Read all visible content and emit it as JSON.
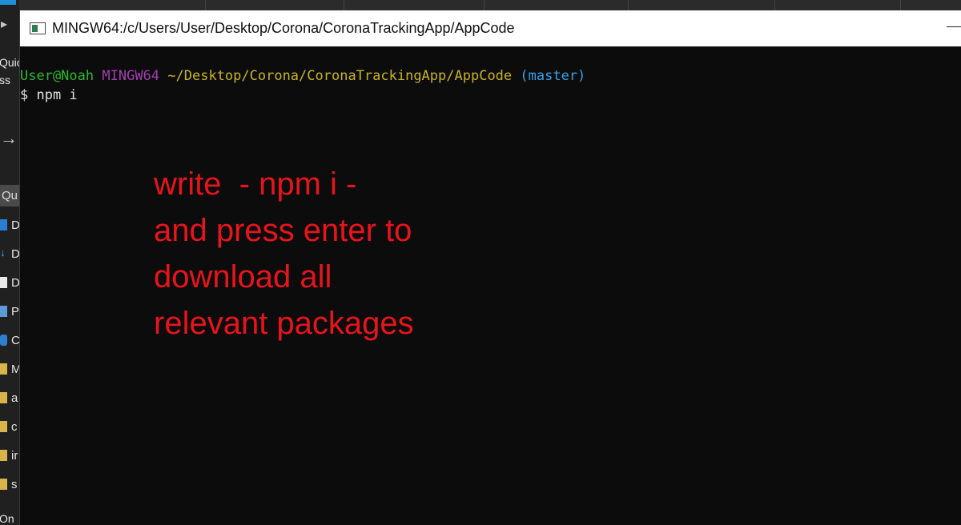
{
  "background_explorer": {
    "quick_access_fragment_1": "Quic",
    "quick_access_fragment_2": "ss",
    "search_fragment": "Qu",
    "tree_items": [
      "D",
      "D",
      "D",
      "P",
      "C",
      "M",
      "a",
      "c",
      "ir",
      "s"
    ],
    "bottom_fragment": "On"
  },
  "terminal": {
    "window_title": "MINGW64:/c/Users/User/Desktop/Corona/CoronaTrackingApp/AppCode",
    "prompt": {
      "user_host": "User@Noah",
      "shell": "MINGW64",
      "path": "~/Desktop/Corona/CoronaTrackingApp/AppCode",
      "branch": "(master)"
    },
    "command_line": "$ npm i"
  },
  "annotation": {
    "lines": [
      "write  - npm i -",
      "and press enter to",
      "download all",
      "relevant packages"
    ],
    "color": "#e8141c"
  },
  "colors": {
    "terminal_bg": "#0c0c0c",
    "user_host": "#2eb82e",
    "shell": "#a23fb0",
    "path": "#c9b324",
    "branch": "#3aa0e8"
  }
}
